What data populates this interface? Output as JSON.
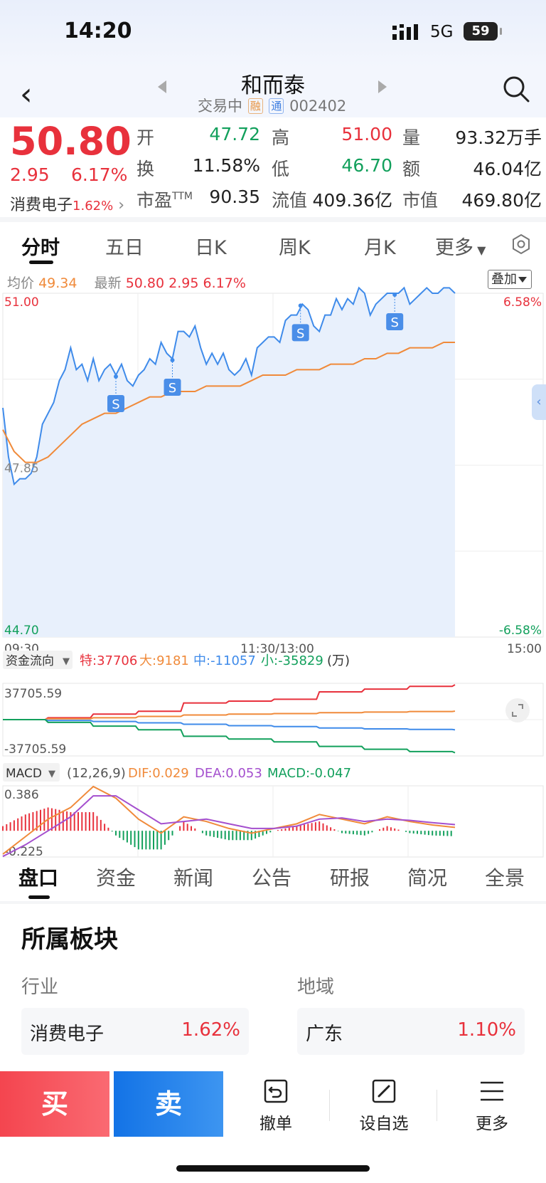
{
  "status_bar": {
    "time": "14:20",
    "network": "5G",
    "battery": "59"
  },
  "header": {
    "stock_name": "和而泰",
    "status": "交易中",
    "tag_rong": "融",
    "tag_tong": "通",
    "code": "002402"
  },
  "quote": {
    "price": "50.80",
    "change": "2.95",
    "change_pct": "6.17%",
    "sector_name": "消费电子",
    "sector_pct": "1.62%",
    "fields": [
      {
        "label": "开",
        "value": "47.72",
        "color": "#12a05c"
      },
      {
        "label": "高",
        "value": "51.00",
        "color": "#e8313c"
      },
      {
        "label": "量",
        "value": "93.32万手",
        "color": "#222222"
      },
      {
        "label": "换",
        "value": "11.58%",
        "color": "#222222"
      },
      {
        "label": "低",
        "value": "46.70",
        "color": "#12a05c"
      },
      {
        "label": "额",
        "value": "46.04亿",
        "color": "#222222"
      },
      {
        "label": "市盈TTM",
        "value": "90.35",
        "color": "#222222"
      },
      {
        "label": "流值",
        "value": "409.36亿",
        "color": "#222222"
      },
      {
        "label": "市值",
        "value": "469.80亿",
        "color": "#222222"
      }
    ]
  },
  "chart_tabs": [
    "分时",
    "五日",
    "日K",
    "周K",
    "月K",
    "更多"
  ],
  "intraday_legend": {
    "avg_label": "均价",
    "avg_value": "49.34",
    "latest_label": "最新",
    "latest_value": "50.80",
    "latest_change": "2.95",
    "latest_pct": "6.17%",
    "overlay_button": "叠加"
  },
  "chart_data": [
    {
      "type": "line",
      "title": "",
      "ylim": [
        44.7,
        51.0
      ],
      "y_tick_labels": [
        "51.00",
        "47.85",
        "44.70"
      ],
      "right_tick_labels": [
        "6.58%",
        "-6.58%"
      ],
      "x_tick_labels": [
        "09:30",
        "11:30/13:00",
        "15:00"
      ],
      "x_index_range": [
        0,
        240
      ],
      "series": [
        {
          "name": "最新",
          "color": "#3f8bea",
          "x": [
            0,
            3,
            6,
            9,
            12,
            15,
            18,
            21,
            24,
            27,
            30,
            33,
            36,
            39,
            42,
            45,
            48,
            51,
            54,
            57,
            60,
            63,
            66,
            69,
            72,
            75,
            78,
            81,
            84,
            87,
            90,
            93,
            96,
            99,
            102,
            105,
            108,
            111,
            114,
            117,
            120,
            123,
            126,
            129,
            132,
            135,
            138,
            141,
            144,
            147,
            150,
            153,
            156,
            159,
            162,
            165,
            168,
            171,
            174,
            177,
            180,
            183,
            186,
            189,
            192,
            195,
            198,
            201,
            204,
            207,
            210,
            213,
            216,
            219,
            222,
            225,
            228,
            231,
            234,
            237,
            240
          ],
          "values": [
            48.9,
            48.0,
            47.5,
            47.6,
            47.6,
            47.7,
            48.0,
            48.6,
            48.8,
            49.0,
            49.4,
            49.6,
            50.0,
            49.6,
            49.7,
            49.4,
            49.8,
            49.4,
            49.6,
            49.7,
            49.5,
            49.7,
            49.4,
            49.3,
            49.5,
            49.6,
            49.8,
            49.7,
            50.1,
            49.9,
            49.8,
            50.3,
            50.3,
            50.2,
            50.4,
            50.0,
            49.7,
            49.9,
            49.7,
            49.9,
            49.6,
            49.5,
            49.6,
            49.8,
            49.5,
            50.0,
            50.1,
            50.2,
            50.2,
            50.1,
            50.5,
            50.6,
            50.6,
            50.8,
            50.7,
            50.4,
            50.3,
            50.6,
            50.6,
            50.9,
            50.7,
            50.9,
            50.8,
            51.1,
            51.0,
            50.6,
            50.8,
            50.9,
            51.0,
            51.0,
            51.0,
            51.1,
            50.8,
            50.9,
            51.0,
            51.1,
            51.0,
            51.0,
            51.1,
            51.1,
            51.0
          ]
        },
        {
          "name": "均价",
          "color": "#f08a3a",
          "x": [
            0,
            6,
            12,
            18,
            24,
            30,
            36,
            42,
            48,
            54,
            60,
            66,
            72,
            78,
            84,
            90,
            96,
            102,
            108,
            114,
            120,
            126,
            132,
            138,
            144,
            150,
            156,
            162,
            168,
            174,
            180,
            186,
            192,
            198,
            204,
            210,
            216,
            222,
            228,
            234,
            240
          ],
          "values": [
            48.5,
            48.1,
            47.9,
            47.9,
            48.0,
            48.2,
            48.4,
            48.6,
            48.7,
            48.8,
            48.8,
            48.9,
            49.0,
            49.1,
            49.1,
            49.2,
            49.2,
            49.2,
            49.3,
            49.3,
            49.3,
            49.3,
            49.4,
            49.5,
            49.5,
            49.5,
            49.6,
            49.6,
            49.6,
            49.7,
            49.7,
            49.7,
            49.8,
            49.8,
            49.9,
            49.9,
            50.0,
            50.0,
            50.0,
            50.1,
            50.1
          ]
        }
      ],
      "markers": [
        {
          "label": "S",
          "x": 60
        },
        {
          "label": "S",
          "x": 90
        },
        {
          "label": "S",
          "x": 158
        },
        {
          "label": "S",
          "x": 208
        }
      ]
    },
    {
      "type": "line",
      "title": "资金流向",
      "legend": [
        {
          "label": "特:37706",
          "color": "#e8313c"
        },
        {
          "label": "大:9181",
          "color": "#f08a3a"
        },
        {
          "label": "中:-11057",
          "color": "#3f8bea"
        },
        {
          "label": "小:-35829",
          "color": "#12a05c"
        }
      ],
      "unit": "(万)",
      "ylim": [
        -37705.59,
        37705.59
      ],
      "y_tick_labels": [
        "37705.59",
        "-37705.59"
      ],
      "x": [
        0,
        24,
        48,
        72,
        96,
        120,
        144,
        168,
        192,
        216,
        240
      ],
      "series": [
        {
          "name": "特",
          "color": "#e8313c",
          "values": [
            0,
            2000,
            6000,
            9000,
            18000,
            20000,
            22000,
            30000,
            33000,
            36000,
            37706
          ]
        },
        {
          "name": "大",
          "color": "#f08a3a",
          "values": [
            0,
            1000,
            2000,
            3500,
            5000,
            6000,
            6500,
            7500,
            8200,
            8800,
            9181
          ]
        },
        {
          "name": "中",
          "color": "#3f8bea",
          "values": [
            0,
            -1000,
            -2000,
            -3500,
            -5000,
            -6500,
            -7500,
            -9000,
            -10000,
            -10600,
            -11057
          ]
        },
        {
          "name": "小",
          "color": "#12a05c",
          "values": [
            0,
            -3000,
            -7000,
            -11000,
            -18000,
            -21000,
            -24000,
            -29000,
            -32000,
            -34500,
            -35829
          ]
        }
      ]
    },
    {
      "type": "bar",
      "title": "MACD",
      "params": "(12,26,9)",
      "legend": [
        {
          "label": "DIF:0.029",
          "color": "#f08a3a"
        },
        {
          "label": "DEA:0.053",
          "color": "#a44fce"
        },
        {
          "label": "MACD:-0.047",
          "color": "#12a05c"
        }
      ],
      "ylim": [
        -0.225,
        0.386
      ],
      "y_tick_labels": [
        "0.386",
        "-0.225"
      ],
      "x": [
        0,
        12,
        24,
        36,
        48,
        60,
        72,
        84,
        96,
        108,
        120,
        132,
        144,
        156,
        168,
        180,
        192,
        204,
        216,
        228,
        240
      ],
      "dif": [
        -0.2,
        -0.05,
        0.1,
        0.2,
        0.38,
        0.28,
        0.1,
        -0.02,
        0.12,
        0.08,
        0.02,
        -0.02,
        0.02,
        0.06,
        0.14,
        0.1,
        0.06,
        0.12,
        0.08,
        0.05,
        0.029
      ],
      "dea": [
        -0.22,
        -0.12,
        0.0,
        0.12,
        0.3,
        0.3,
        0.18,
        0.06,
        0.08,
        0.1,
        0.06,
        0.02,
        0.02,
        0.04,
        0.1,
        0.11,
        0.08,
        0.1,
        0.09,
        0.07,
        0.053
      ],
      "macd": [
        0.04,
        0.14,
        0.2,
        0.16,
        0.16,
        -0.04,
        -0.16,
        -0.16,
        0.08,
        -0.04,
        -0.08,
        -0.08,
        0.0,
        0.04,
        0.08,
        -0.02,
        -0.04,
        0.04,
        -0.02,
        -0.04,
        -0.047
      ]
    }
  ],
  "flow_panel": {
    "dropdown": "资金流向"
  },
  "macd_panel": {
    "dropdown": "MACD"
  },
  "bottom_tabs": [
    "盘口",
    "资金",
    "新闻",
    "公告",
    "研报",
    "简况",
    "全景"
  ],
  "sector_section": {
    "title": "所属板块",
    "industry_label": "行业",
    "region_label": "地域",
    "industry_name": "消费电子",
    "industry_pct": "1.62%",
    "region_name": "广东",
    "region_pct": "1.10%"
  },
  "bottom_bar": {
    "buy": "买",
    "sell": "卖",
    "cancel": "撤单",
    "watchlist": "设自选",
    "more": "更多"
  }
}
